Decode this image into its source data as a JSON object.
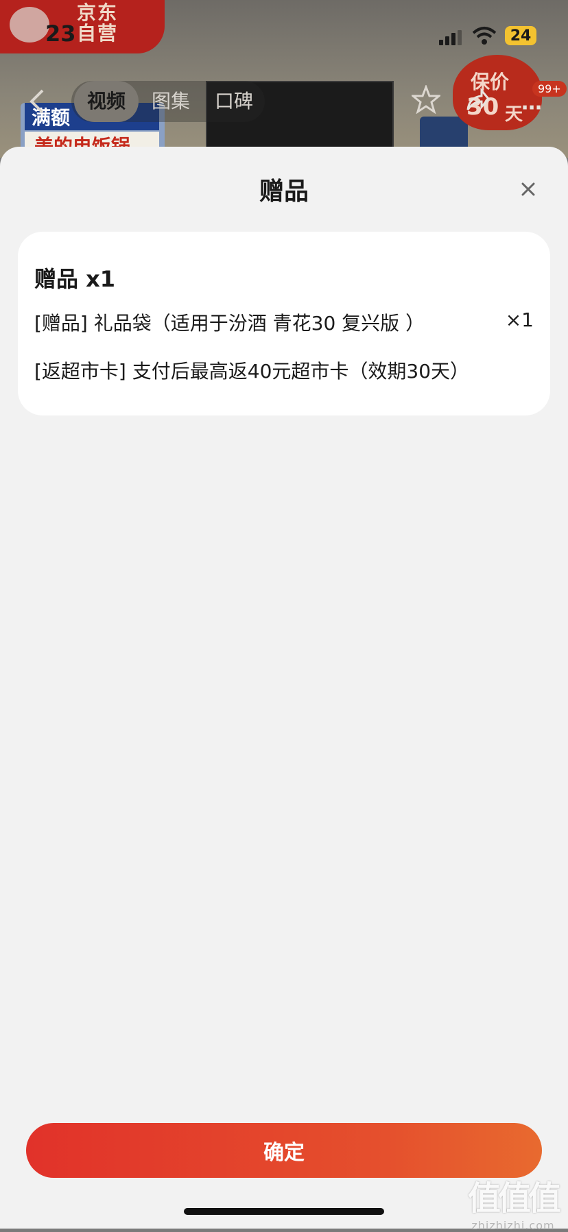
{
  "background": {
    "jd_badge_text": "京东 自营",
    "status_time": "23",
    "battery": "24",
    "tabs": [
      {
        "label": "视频",
        "active": true
      },
      {
        "label": "图集",
        "active": false
      },
      {
        "label": "口碑",
        "active": false
      }
    ],
    "guarantee": {
      "line1": "保价",
      "days": "30",
      "unit": "天"
    },
    "notification_badge": "99+",
    "banner_line1": "满额",
    "banner_line2": "美的电饭锅"
  },
  "sheet": {
    "title": "赠品",
    "close_label": "×",
    "card": {
      "heading": "赠品 x1",
      "items": [
        {
          "text": "[赠品] 礼品袋（适用于汾酒 青花30 复兴版 ）",
          "qty": "×1"
        },
        {
          "text": "[返超市卡] 支付后最高返40元超市卡（效期30天）",
          "qty": ""
        }
      ]
    },
    "confirm_label": "确定"
  },
  "watermark": {
    "main": "值值值",
    "sub": "zhizhizhi.com"
  },
  "colors": {
    "accent": "#e1322a",
    "sheet_bg": "#f2f2f2",
    "card_bg": "#ffffff"
  }
}
